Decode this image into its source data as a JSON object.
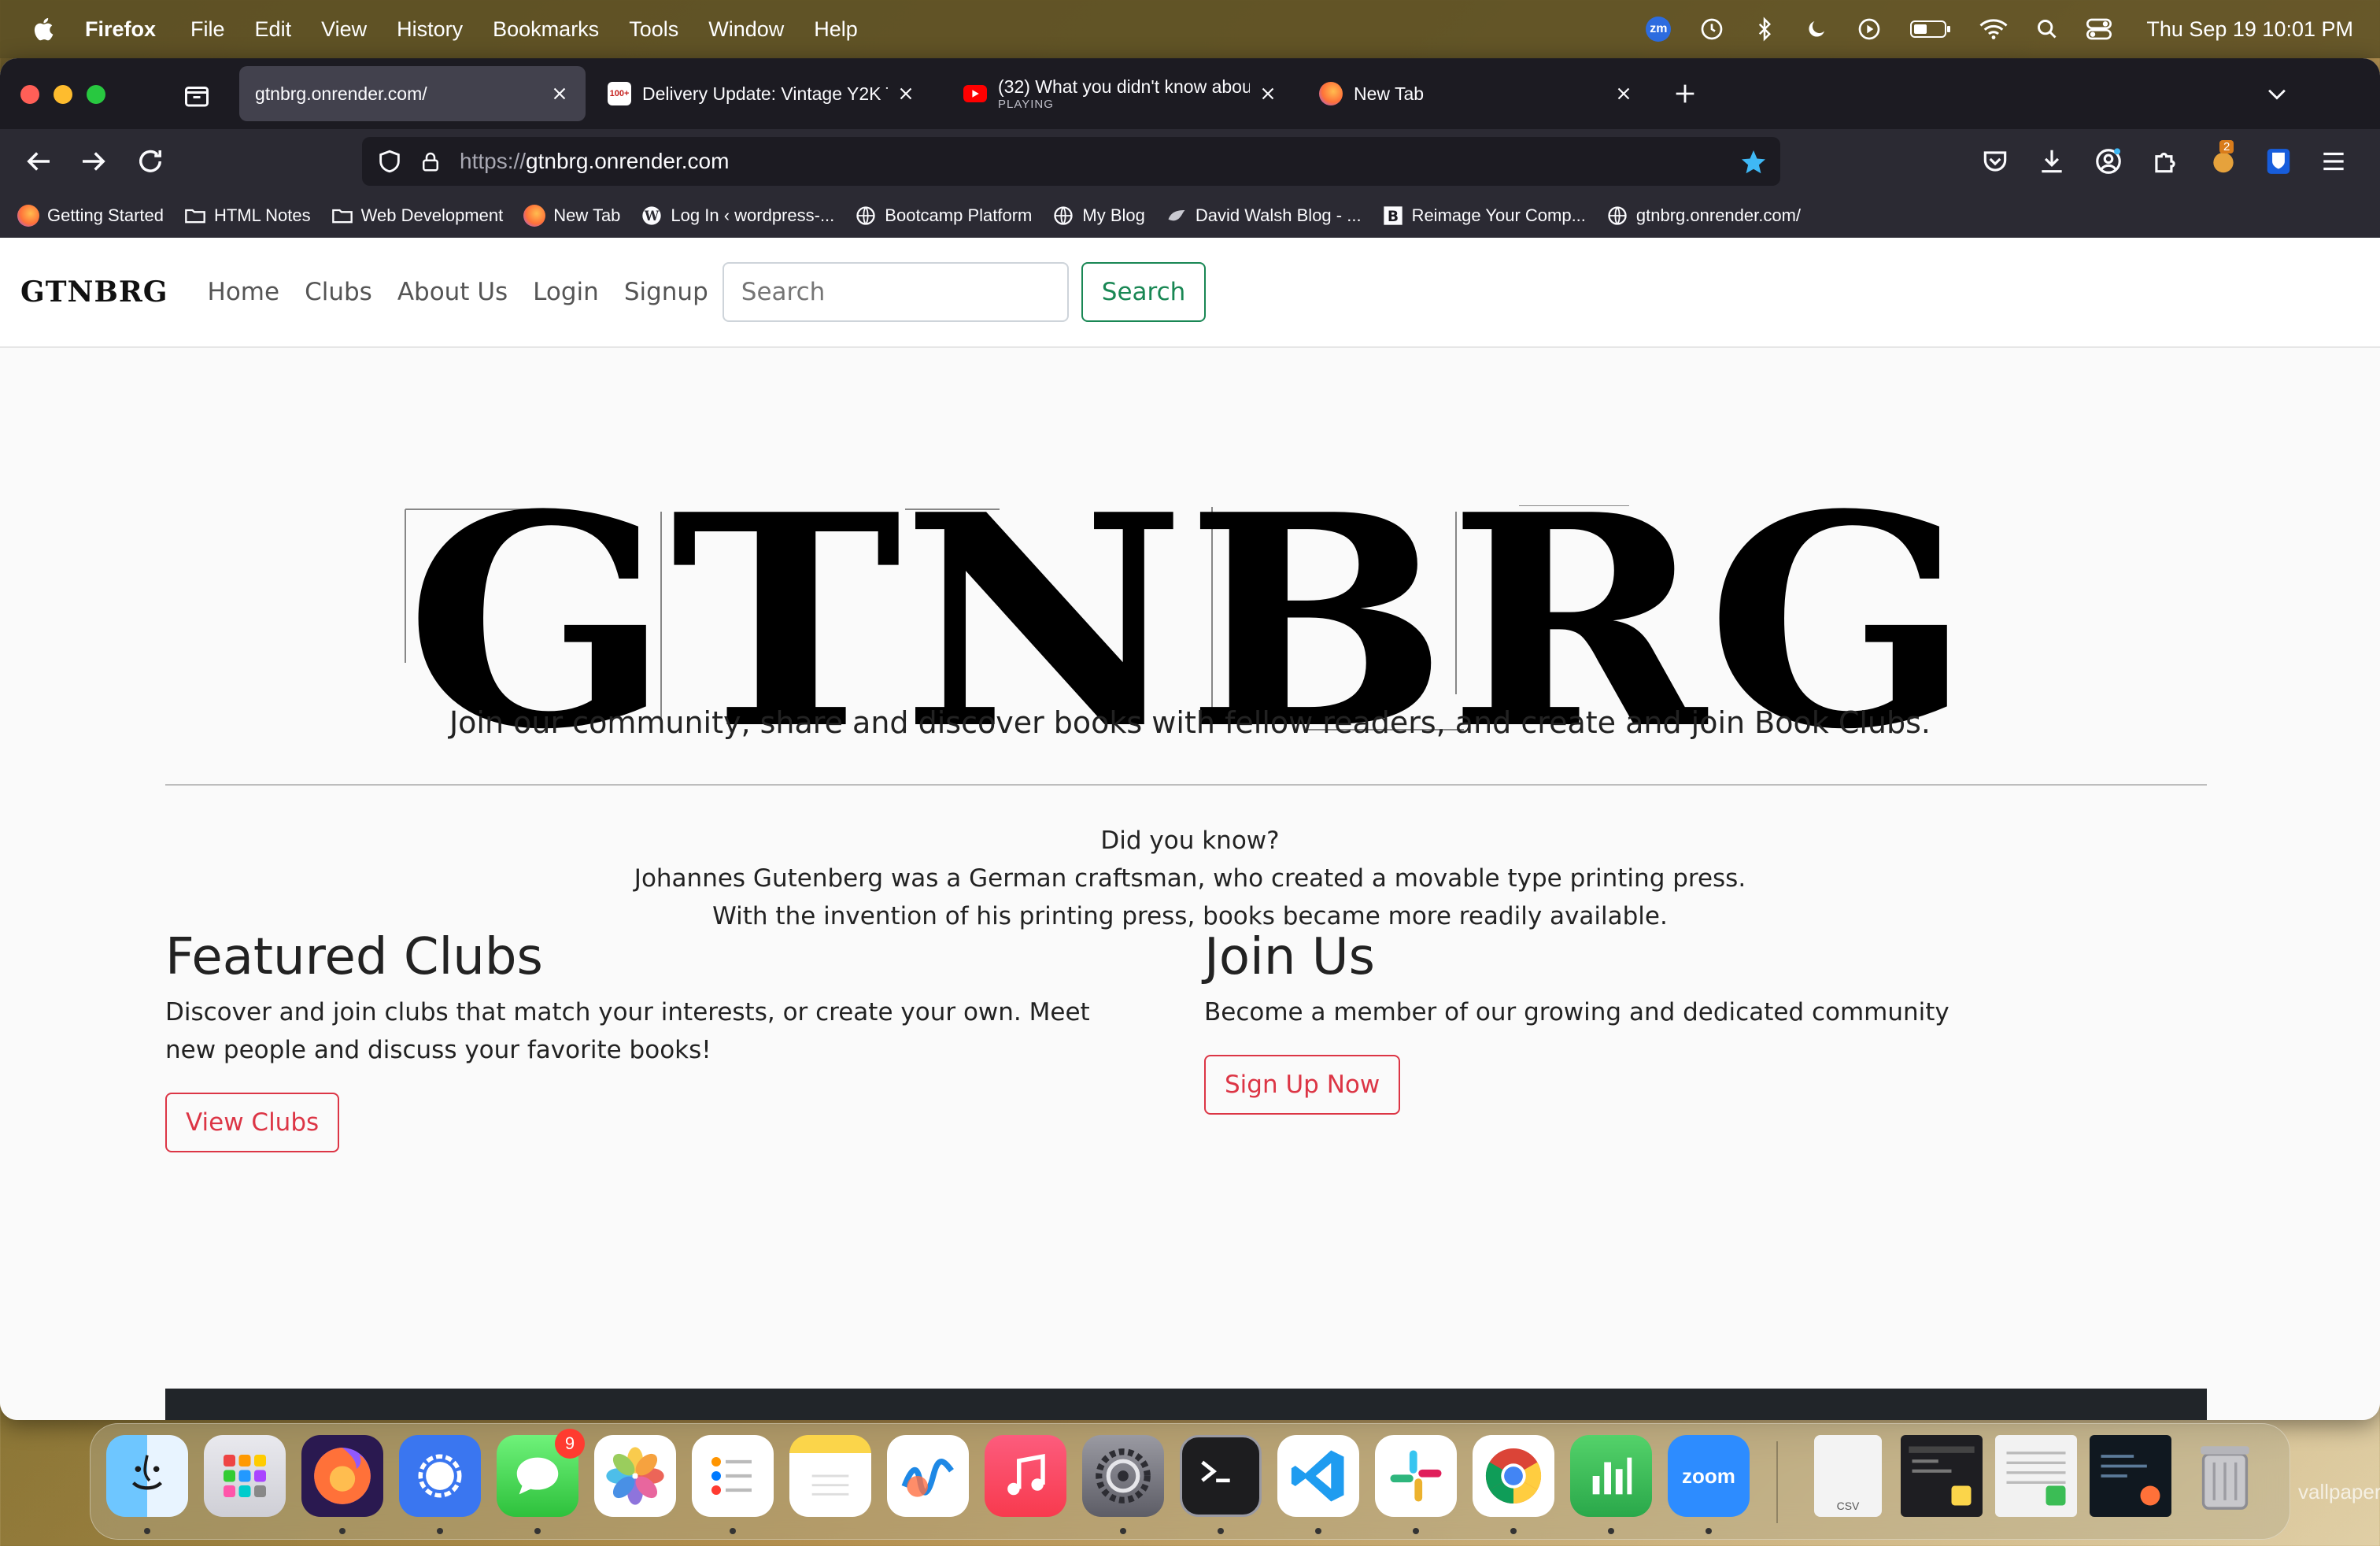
{
  "menubar": {
    "app_name": "Firefox",
    "items": [
      "File",
      "Edit",
      "View",
      "History",
      "Bookmarks",
      "Tools",
      "Window",
      "Help"
    ],
    "zoom_badge": "zm",
    "clock": "Thu Sep 19  10:01 PM"
  },
  "tabs": [
    {
      "title": "gtnbrg.onrender.com/",
      "active": true
    },
    {
      "title": "Delivery Update: Vintage Y2K T(",
      "favicon_text": "100+"
    },
    {
      "title": "(32) What you didn't know abou",
      "subtitle": "PLAYING"
    },
    {
      "title": "New Tab"
    }
  ],
  "urlbar": {
    "scheme": "https://",
    "host": "gtnbrg.onrender.com"
  },
  "toolbar": {
    "extension_badge": "2"
  },
  "bookmarks": [
    {
      "label": "Getting Started",
      "icon": "firefox-icon"
    },
    {
      "label": "HTML Notes",
      "icon": "folder-icon"
    },
    {
      "label": "Web Development",
      "icon": "folder-icon"
    },
    {
      "label": "New Tab",
      "icon": "firefox-icon"
    },
    {
      "label": "Log In ‹ wordpress-...",
      "icon": "wordpress-icon"
    },
    {
      "label": "Bootcamp Platform",
      "icon": "globe-icon"
    },
    {
      "label": "My Blog",
      "icon": "globe-icon"
    },
    {
      "label": "David Walsh Blog - ...",
      "icon": "blog-icon"
    },
    {
      "label": "Reimage Your Comp...",
      "icon": "b-icon"
    },
    {
      "label": "gtnbrg.onrender.com/",
      "icon": "globe-icon"
    }
  ],
  "site": {
    "brand": "GTNBRG",
    "nav": [
      "Home",
      "Clubs",
      "About Us",
      "Login",
      "Signup"
    ],
    "search_placeholder": "Search",
    "search_button": "Search",
    "hero_logo_text": "GTNBRG",
    "tagline": "Join our community, share and discover books with fellow readers, and create and join Book Clubs.",
    "facts": [
      "Did you know?",
      "Johannes Gutenberg was a German craftsman, who created a movable type printing press.",
      "With the invention of his printing press, books became more readily available."
    ],
    "featured": {
      "heading": "Featured Clubs",
      "text": "Discover and join clubs that match your interests, or create your own. Meet new people and discuss your favorite books!",
      "button": "View Clubs"
    },
    "join": {
      "heading": "Join Us",
      "text": "Become a member of our growing and dedicated community",
      "button": "Sign Up Now"
    }
  },
  "colors": {
    "primary_outline_green": "#198754",
    "danger_outline_red": "#dc3545",
    "firefox_chrome": "#1c1b22",
    "toolbar_bg": "#2b2a33"
  },
  "dock": {
    "apps": [
      "Finder",
      "Launchpad",
      "Firefox",
      "Signal",
      "Messages",
      "Photos",
      "Reminders",
      "Notes",
      "Freeform",
      "Music",
      "System Settings",
      "Terminal",
      "Visual Studio Code",
      "Slack",
      "Chrome",
      "Numbers",
      "Zoom"
    ],
    "messages_badge": "9",
    "zoom_label": "zoom",
    "csv_label": "CSV"
  },
  "wallpaper_label": "vallpaper."
}
